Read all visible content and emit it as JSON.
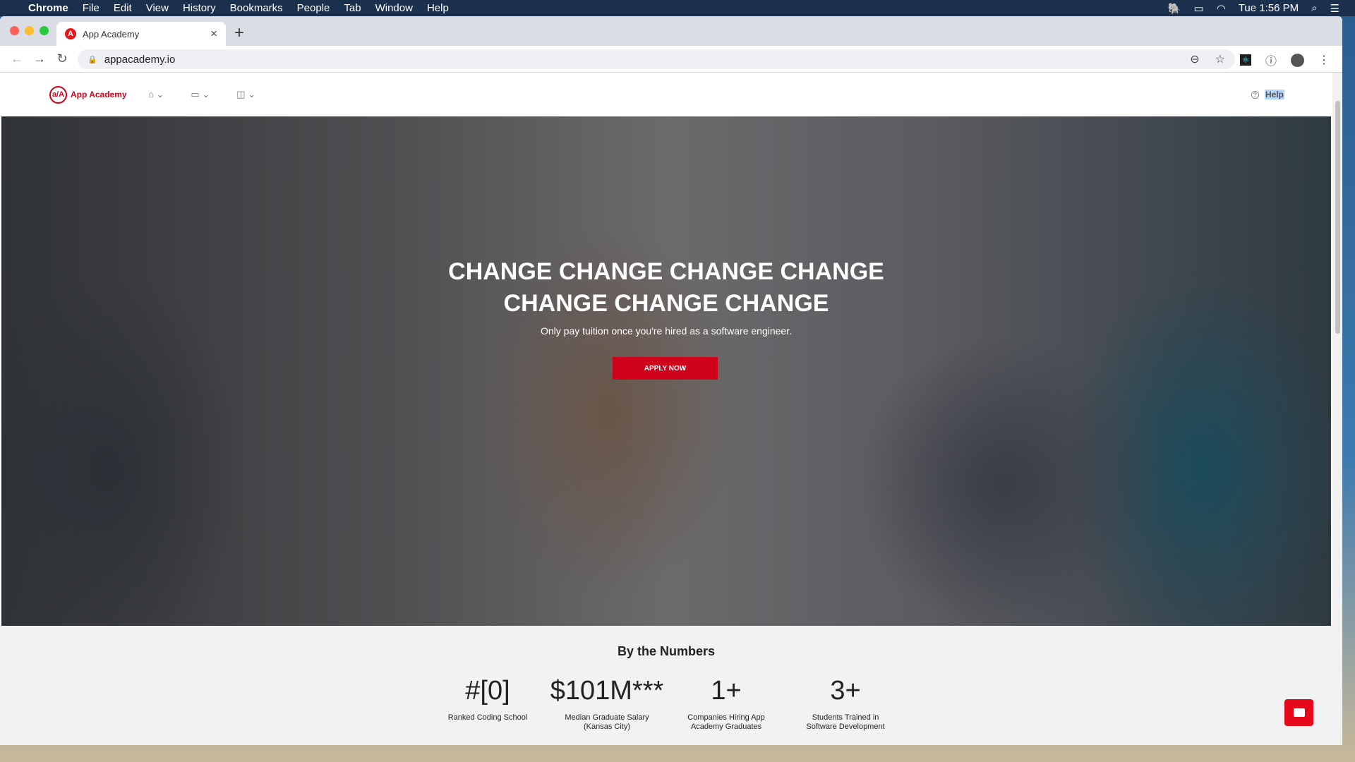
{
  "menubar": {
    "apple": "",
    "app": "Chrome",
    "items": [
      "File",
      "Edit",
      "View",
      "History",
      "Bookmarks",
      "People",
      "Tab",
      "Window",
      "Help"
    ],
    "clock": "Tue 1:56 PM"
  },
  "browser": {
    "tab_title": "App Academy",
    "favicon": "A",
    "url": "appacademy.io"
  },
  "site": {
    "logo_mark": "a/A",
    "logo_text": "App Academy",
    "help": "Help",
    "brand_color": "#d0021b"
  },
  "hero": {
    "title_line1": "CHANGE CHANGE CHANGE CHANGE",
    "title_line2": "CHANGE CHANGE CHANGE",
    "subtitle": "Only pay tuition once you're hired as a software engineer.",
    "cta": "APPLY NOW"
  },
  "stats": {
    "heading": "By the Numbers",
    "items": [
      {
        "value": "#[0]",
        "label": "Ranked Coding School"
      },
      {
        "value": "$101M***",
        "label": "Median Graduate Salary (Kansas City)"
      },
      {
        "value": "1+",
        "label": "Companies Hiring App Academy Graduates"
      },
      {
        "value": "3+",
        "label": "Students Trained in Software Development"
      }
    ]
  }
}
